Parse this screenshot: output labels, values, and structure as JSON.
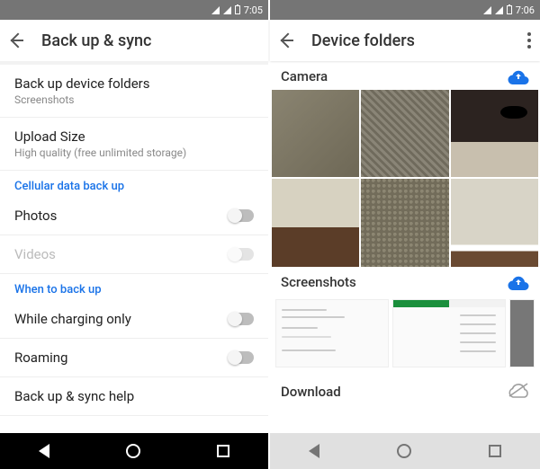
{
  "left": {
    "status_time": "7:05",
    "toolbar_title": "Back up & sync",
    "rows": {
      "device_folders": {
        "title": "Back up device folders",
        "subtitle": "Screenshots"
      },
      "upload_size": {
        "title": "Upload Size",
        "subtitle": "High quality (free unlimited storage)"
      }
    },
    "section_cellular": "Cellular data back up",
    "toggle_photos": "Photos",
    "toggle_videos": "Videos",
    "section_when": "When to back up",
    "toggle_charging": "While charging only",
    "toggle_roaming": "Roaming",
    "help": "Back up & sync help"
  },
  "right": {
    "status_time": "7:06",
    "toolbar_title": "Device folders",
    "folders": {
      "camera": "Camera",
      "screenshots": "Screenshots",
      "download": "Download"
    }
  }
}
